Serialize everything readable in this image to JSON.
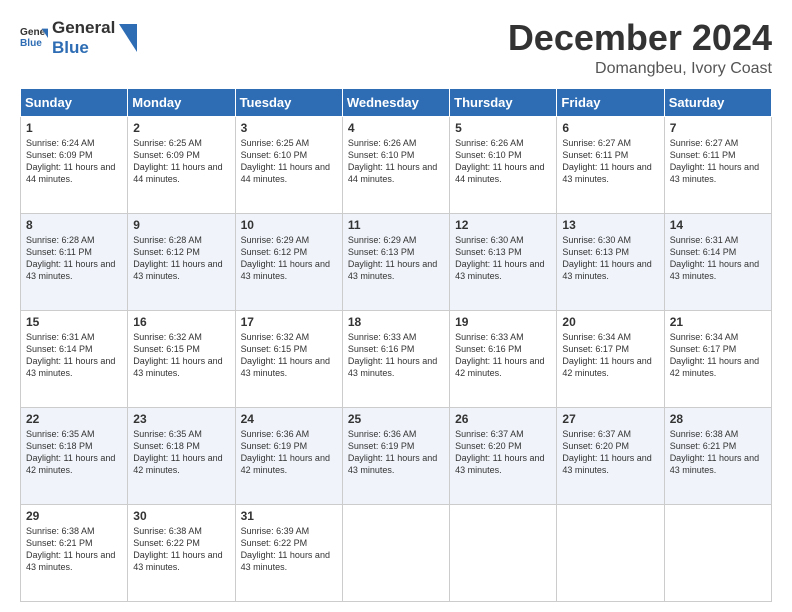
{
  "logo": {
    "line1": "General",
    "line2": "Blue"
  },
  "header": {
    "title": "December 2024",
    "subtitle": "Domangbeu, Ivory Coast"
  },
  "weekdays": [
    "Sunday",
    "Monday",
    "Tuesday",
    "Wednesday",
    "Thursday",
    "Friday",
    "Saturday"
  ],
  "weeks": [
    [
      {
        "day": "1",
        "sunrise": "6:24 AM",
        "sunset": "6:09 PM",
        "daylight": "11 hours and 44 minutes."
      },
      {
        "day": "2",
        "sunrise": "6:25 AM",
        "sunset": "6:09 PM",
        "daylight": "11 hours and 44 minutes."
      },
      {
        "day": "3",
        "sunrise": "6:25 AM",
        "sunset": "6:10 PM",
        "daylight": "11 hours and 44 minutes."
      },
      {
        "day": "4",
        "sunrise": "6:26 AM",
        "sunset": "6:10 PM",
        "daylight": "11 hours and 44 minutes."
      },
      {
        "day": "5",
        "sunrise": "6:26 AM",
        "sunset": "6:10 PM",
        "daylight": "11 hours and 44 minutes."
      },
      {
        "day": "6",
        "sunrise": "6:27 AM",
        "sunset": "6:11 PM",
        "daylight": "11 hours and 43 minutes."
      },
      {
        "day": "7",
        "sunrise": "6:27 AM",
        "sunset": "6:11 PM",
        "daylight": "11 hours and 43 minutes."
      }
    ],
    [
      {
        "day": "8",
        "sunrise": "6:28 AM",
        "sunset": "6:11 PM",
        "daylight": "11 hours and 43 minutes."
      },
      {
        "day": "9",
        "sunrise": "6:28 AM",
        "sunset": "6:12 PM",
        "daylight": "11 hours and 43 minutes."
      },
      {
        "day": "10",
        "sunrise": "6:29 AM",
        "sunset": "6:12 PM",
        "daylight": "11 hours and 43 minutes."
      },
      {
        "day": "11",
        "sunrise": "6:29 AM",
        "sunset": "6:13 PM",
        "daylight": "11 hours and 43 minutes."
      },
      {
        "day": "12",
        "sunrise": "6:30 AM",
        "sunset": "6:13 PM",
        "daylight": "11 hours and 43 minutes."
      },
      {
        "day": "13",
        "sunrise": "6:30 AM",
        "sunset": "6:13 PM",
        "daylight": "11 hours and 43 minutes."
      },
      {
        "day": "14",
        "sunrise": "6:31 AM",
        "sunset": "6:14 PM",
        "daylight": "11 hours and 43 minutes."
      }
    ],
    [
      {
        "day": "15",
        "sunrise": "6:31 AM",
        "sunset": "6:14 PM",
        "daylight": "11 hours and 43 minutes."
      },
      {
        "day": "16",
        "sunrise": "6:32 AM",
        "sunset": "6:15 PM",
        "daylight": "11 hours and 43 minutes."
      },
      {
        "day": "17",
        "sunrise": "6:32 AM",
        "sunset": "6:15 PM",
        "daylight": "11 hours and 43 minutes."
      },
      {
        "day": "18",
        "sunrise": "6:33 AM",
        "sunset": "6:16 PM",
        "daylight": "11 hours and 43 minutes."
      },
      {
        "day": "19",
        "sunrise": "6:33 AM",
        "sunset": "6:16 PM",
        "daylight": "11 hours and 42 minutes."
      },
      {
        "day": "20",
        "sunrise": "6:34 AM",
        "sunset": "6:17 PM",
        "daylight": "11 hours and 42 minutes."
      },
      {
        "day": "21",
        "sunrise": "6:34 AM",
        "sunset": "6:17 PM",
        "daylight": "11 hours and 42 minutes."
      }
    ],
    [
      {
        "day": "22",
        "sunrise": "6:35 AM",
        "sunset": "6:18 PM",
        "daylight": "11 hours and 42 minutes."
      },
      {
        "day": "23",
        "sunrise": "6:35 AM",
        "sunset": "6:18 PM",
        "daylight": "11 hours and 42 minutes."
      },
      {
        "day": "24",
        "sunrise": "6:36 AM",
        "sunset": "6:19 PM",
        "daylight": "11 hours and 42 minutes."
      },
      {
        "day": "25",
        "sunrise": "6:36 AM",
        "sunset": "6:19 PM",
        "daylight": "11 hours and 43 minutes."
      },
      {
        "day": "26",
        "sunrise": "6:37 AM",
        "sunset": "6:20 PM",
        "daylight": "11 hours and 43 minutes."
      },
      {
        "day": "27",
        "sunrise": "6:37 AM",
        "sunset": "6:20 PM",
        "daylight": "11 hours and 43 minutes."
      },
      {
        "day": "28",
        "sunrise": "6:38 AM",
        "sunset": "6:21 PM",
        "daylight": "11 hours and 43 minutes."
      }
    ],
    [
      {
        "day": "29",
        "sunrise": "6:38 AM",
        "sunset": "6:21 PM",
        "daylight": "11 hours and 43 minutes."
      },
      {
        "day": "30",
        "sunrise": "6:38 AM",
        "sunset": "6:22 PM",
        "daylight": "11 hours and 43 minutes."
      },
      {
        "day": "31",
        "sunrise": "6:39 AM",
        "sunset": "6:22 PM",
        "daylight": "11 hours and 43 minutes."
      },
      null,
      null,
      null,
      null
    ]
  ]
}
